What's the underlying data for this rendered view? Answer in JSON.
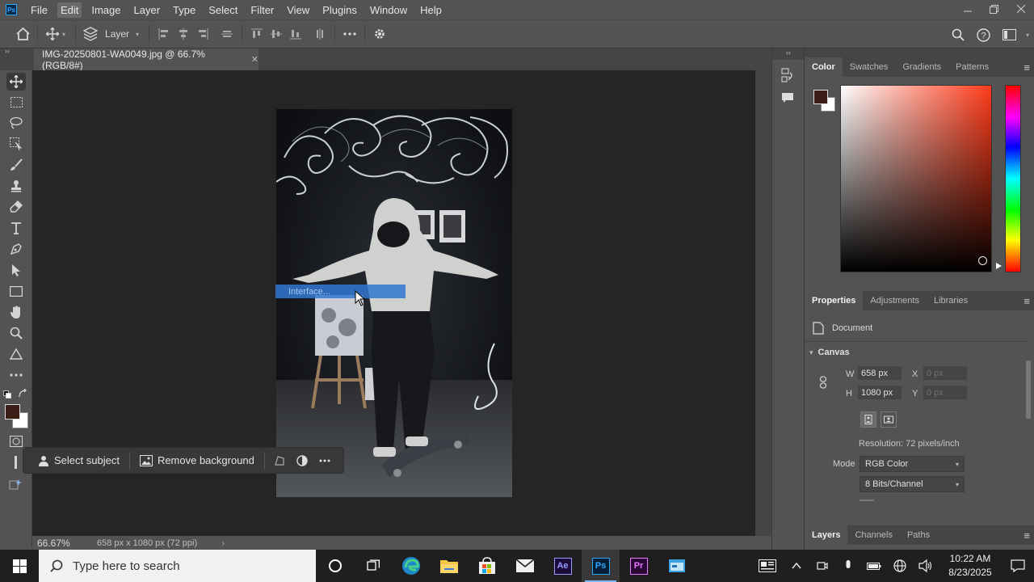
{
  "app": {
    "logo_text": "Ps",
    "menu": [
      "File",
      "Edit",
      "Image",
      "Layer",
      "Type",
      "Select",
      "Filter",
      "View",
      "Plugins",
      "Window",
      "Help"
    ],
    "active_menu": "Edit"
  },
  "options_bar": {
    "layer_select": "Layer"
  },
  "document": {
    "tab_title": "IMG-20250801-WA0049.jpg @ 66.7% (RGB/8#)",
    "zoom": "66.67%",
    "info": "658 px x 1080 px (72 ppi)"
  },
  "overlay": {
    "interface_label": "Interface..."
  },
  "contextual_bar": {
    "select_subject": "Select subject",
    "remove_background": "Remove background"
  },
  "color_panel": {
    "tabs": [
      "Color",
      "Swatches",
      "Gradients",
      "Patterns"
    ],
    "foreground": "#3b1f17",
    "background": "#ffffff"
  },
  "properties_panel": {
    "tabs": [
      "Properties",
      "Adjustments",
      "Libraries"
    ],
    "section_type": "Document",
    "canvas_heading": "Canvas",
    "w_label": "W",
    "w_value": "658 px",
    "h_label": "H",
    "h_value": "1080 px",
    "x_label": "X",
    "x_value": "0 px",
    "y_label": "Y",
    "y_value": "0 px",
    "resolution": "Resolution: 72 pixels/inch",
    "mode_label": "Mode",
    "mode_value": "RGB Color",
    "bits_value": "8 Bits/Channel"
  },
  "layers_panel": {
    "tabs": [
      "Layers",
      "Channels",
      "Paths"
    ]
  },
  "taskbar": {
    "search_placeholder": "Type here to search",
    "apps": [
      "cortana",
      "task-view",
      "edge",
      "file-explorer",
      "store",
      "mail",
      "after-effects",
      "photoshop",
      "premiere",
      "control-panel"
    ],
    "ae_label": "Ae",
    "ps_label": "Ps",
    "pr_label": "Pr",
    "time": "10:22 AM",
    "date": "8/23/2025"
  }
}
